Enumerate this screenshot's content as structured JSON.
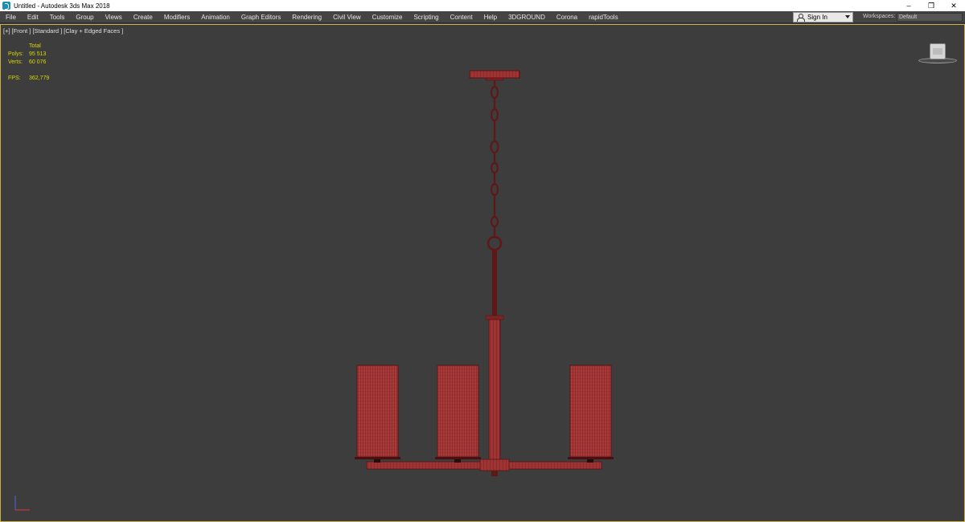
{
  "window": {
    "title": "Untitled - Autodesk 3ds Max 2018",
    "controls": [
      "–",
      "❐",
      "✕"
    ]
  },
  "menu": {
    "items": [
      "File",
      "Edit",
      "Tools",
      "Group",
      "Views",
      "Create",
      "Modifiers",
      "Animation",
      "Graph Editors",
      "Rendering",
      "Civil View",
      "Customize",
      "Scripting",
      "Content",
      "Help",
      "3DGROUND",
      "Corona",
      "rapidTools"
    ],
    "signin": "Sign In",
    "workspaces_label": "Workspaces:",
    "workspace_value": "Default"
  },
  "viewport": {
    "label": "[+] [Front ] [Standard ] [Clay + Edged Faces ]",
    "stats": {
      "total_label": "Total",
      "polys_label": "Polys:",
      "polys_value": "95 513",
      "verts_label": "Verts:",
      "verts_value": "60 076",
      "fps_label": "FPS:",
      "fps_value": "362,779"
    }
  },
  "colors": {
    "viewport_bg": "#3d3d3d",
    "wire": "#6b1a1a",
    "shade_fill": "#a83a3a",
    "stats_text": "#d8d800",
    "active_border": "#c9b04a"
  },
  "icons": {
    "app": "3ds-max-logo-icon",
    "user": "user-icon",
    "dropdown": "chevron-down-icon",
    "viewcube": "viewcube-icon",
    "axis": "axis-tripod-icon"
  }
}
